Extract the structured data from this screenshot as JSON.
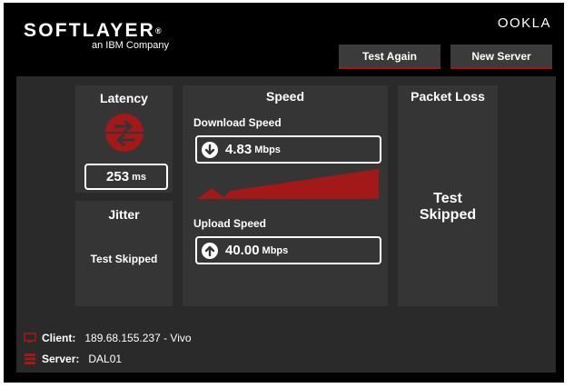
{
  "brand": {
    "logo_text": "SOFTLAYER",
    "logo_reg": "®",
    "logo_sub": "an IBM Company",
    "provider": "OOKLA"
  },
  "buttons": {
    "test_again": "Test Again",
    "new_server": "New Server"
  },
  "latency": {
    "title": "Latency",
    "value": "253",
    "unit": "ms"
  },
  "jitter": {
    "title": "Jitter",
    "status": "Test Skipped"
  },
  "speed": {
    "title": "Speed",
    "download_label": "Download Speed",
    "download_value": "4.83",
    "download_unit": "Mbps",
    "upload_label": "Upload Speed",
    "upload_value": "40.00",
    "upload_unit": "Mbps"
  },
  "packet_loss": {
    "title": "Packet Loss",
    "status_line1": "Test",
    "status_line2": "Skipped"
  },
  "footer": {
    "client_label": "Client:",
    "client_value": "189.68.155.237 - Vivo",
    "server_label": "Server:",
    "server_value": "DAL01"
  },
  "colors": {
    "accent": "#a31818",
    "background": "#000000",
    "panel": "#2a2a2a",
    "card": "#353535"
  },
  "icons": [
    "latency-arrows-icon",
    "download-arrow-icon",
    "upload-arrow-icon",
    "monitor-icon",
    "server-icon"
  ]
}
